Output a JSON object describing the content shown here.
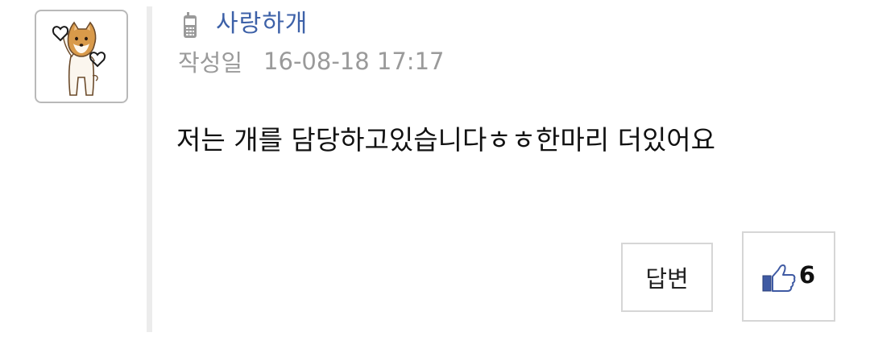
{
  "comment": {
    "author": "사랑하개",
    "meta_label": "작성일",
    "meta_date": "16-08-18 17:17",
    "body": "저는 개를 담당하고있습니다ㅎㅎ한마리 더있어요",
    "reply_label": "답변",
    "like_count": "6"
  },
  "icons": {
    "author_device": "mobile-phone-icon",
    "like": "thumbs-up-icon",
    "avatar": "shiba-dog-with-hearts"
  },
  "colors": {
    "author": "#3d61a8",
    "meta": "#9a9a9a",
    "thumb": "#3f5aa3"
  }
}
